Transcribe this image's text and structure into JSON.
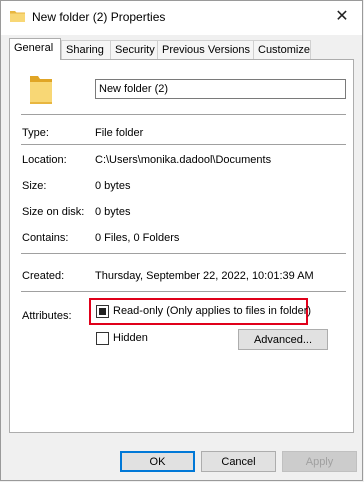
{
  "window": {
    "title": "New folder (2) Properties",
    "close_glyph": "✕"
  },
  "tabs": [
    "General",
    "Sharing",
    "Security",
    "Previous Versions",
    "Customize"
  ],
  "general": {
    "folder_name": "New folder (2)",
    "type_label": "Type:",
    "type_value": "File folder",
    "location_label": "Location:",
    "location_value": "C:\\Users\\monika.dadool\\Documents",
    "size_label": "Size:",
    "size_value": "0 bytes",
    "size_on_disk_label": "Size on disk:",
    "size_on_disk_value": "0 bytes",
    "contains_label": "Contains:",
    "contains_value": "0 Files, 0 Folders",
    "created_label": "Created:",
    "created_value": "Thursday, September 22, 2022, 10:01:39 AM",
    "attributes_label": "Attributes:",
    "readonly_label": "Read-only (Only applies to files in folder)",
    "readonly_state": "indeterminate",
    "hidden_label": "Hidden",
    "hidden_state": "unchecked",
    "advanced_label": "Advanced..."
  },
  "buttons": {
    "ok": "OK",
    "cancel": "Cancel",
    "apply": "Apply"
  },
  "colors": {
    "highlight_border": "#e0001a",
    "folder_yellow": "#f8d775",
    "primary_button_border": "#0078d7"
  },
  "icons": {
    "title": "folder-icon",
    "folder": "folder-icon",
    "close": "close-icon"
  }
}
